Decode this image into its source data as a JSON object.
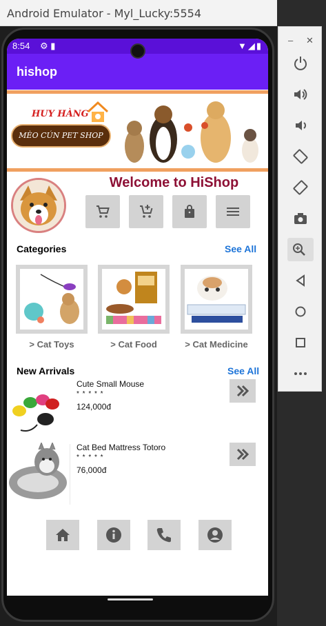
{
  "window": {
    "title": "Android Emulator - Myl_Lucky:5554"
  },
  "status": {
    "time": "8:54"
  },
  "appbar": {
    "title": "hishop"
  },
  "banner": {
    "brand": "HUY HÀNG",
    "tagline": "MÈO CÚN PET SHOP"
  },
  "welcome": "Welcome to HiShop",
  "quick_actions": [
    "cart-icon",
    "add-to-cart-icon",
    "bag-icon",
    "menu-icon"
  ],
  "categories": {
    "title": "Categories",
    "see_all": "See All",
    "items": [
      {
        "label": "> Cat Toys"
      },
      {
        "label": "> Cat Food"
      },
      {
        "label": "> Cat Medicine"
      }
    ]
  },
  "new_arrivals": {
    "title": "New Arrivals",
    "see_all": "See All",
    "items": [
      {
        "name": "Cute Small Mouse",
        "stars": "* * * * *",
        "price": "124,000đ"
      },
      {
        "name": "Cat Bed Mattress Totoro",
        "stars": "* * * * *",
        "price": "76,000đ"
      }
    ]
  },
  "bottom_nav": [
    "home-icon",
    "info-icon",
    "phone-icon",
    "account-icon"
  ],
  "colors": {
    "appbar": "#6b1ff5",
    "statusbar": "#5a10d8",
    "welcome": "#8d1035",
    "link": "#1d74d8",
    "button": "#d3d3d3"
  }
}
